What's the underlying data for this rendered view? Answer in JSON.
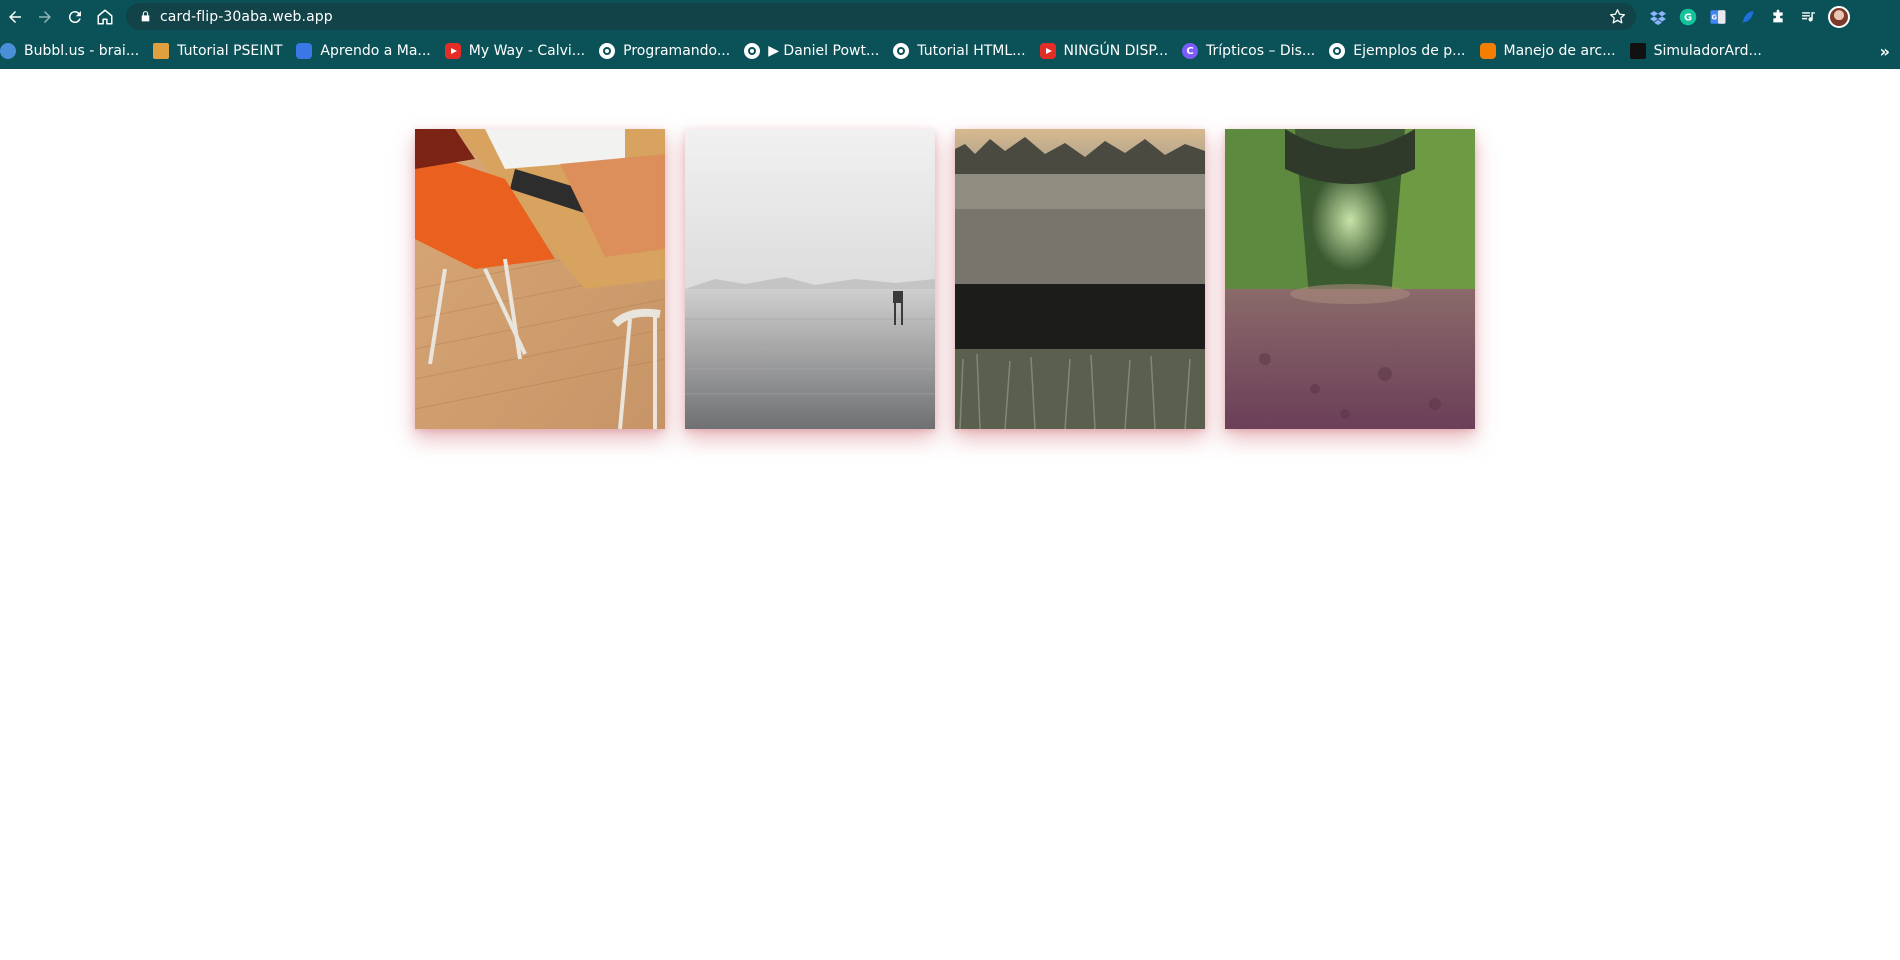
{
  "browser": {
    "url": "card-flip-30aba.web.app",
    "icons": [
      "back-arrow-icon",
      "forward-arrow-icon",
      "reload-icon",
      "home-icon",
      "lock-icon",
      "star-icon"
    ],
    "extensions": [
      "dropbox-icon",
      "grammarly-icon",
      "translate-icon",
      "feather-icon",
      "puzzle-icon",
      "media-control-icon",
      "avatar"
    ],
    "bookmarks": [
      {
        "label": "Bubbl.us - brai...",
        "icon": "cloud"
      },
      {
        "label": "Tutorial PSEINT",
        "icon": "psein"
      },
      {
        "label": "Aprendo a Ma...",
        "icon": "car"
      },
      {
        "label": "My Way - Calvi...",
        "icon": "yt"
      },
      {
        "label": "Programando...",
        "icon": "globe"
      },
      {
        "label": "▶ Daniel Powt...",
        "icon": "globe"
      },
      {
        "label": "Tutorial HTML...",
        "icon": "globe"
      },
      {
        "label": "NINGÚN DISP...",
        "icon": "yt"
      },
      {
        "label": "Trípticos – Dis...",
        "icon": "canva"
      },
      {
        "label": "Ejemplos de p...",
        "icon": "globe"
      },
      {
        "label": "Manejo de arc...",
        "icon": "blogger"
      },
      {
        "label": "SimuladorArd...",
        "icon": "folder"
      }
    ],
    "more_label": "»"
  },
  "page": {
    "cards": [
      {
        "name": "card-desk-chair",
        "image": "desk with orange chair, ruler and notebooks"
      },
      {
        "name": "card-misty-sea",
        "image": "misty grey sea with a lifeguard tower"
      },
      {
        "name": "card-frosty-field",
        "image": "frosty field at dawn with treeline"
      },
      {
        "name": "card-tree-tunnel",
        "image": "green tree tunnel over forest path"
      }
    ],
    "colors": {
      "browser_bg": "#0b5258",
      "omnibox_bg": "#114349",
      "card_shadow": "#c85a64"
    }
  }
}
